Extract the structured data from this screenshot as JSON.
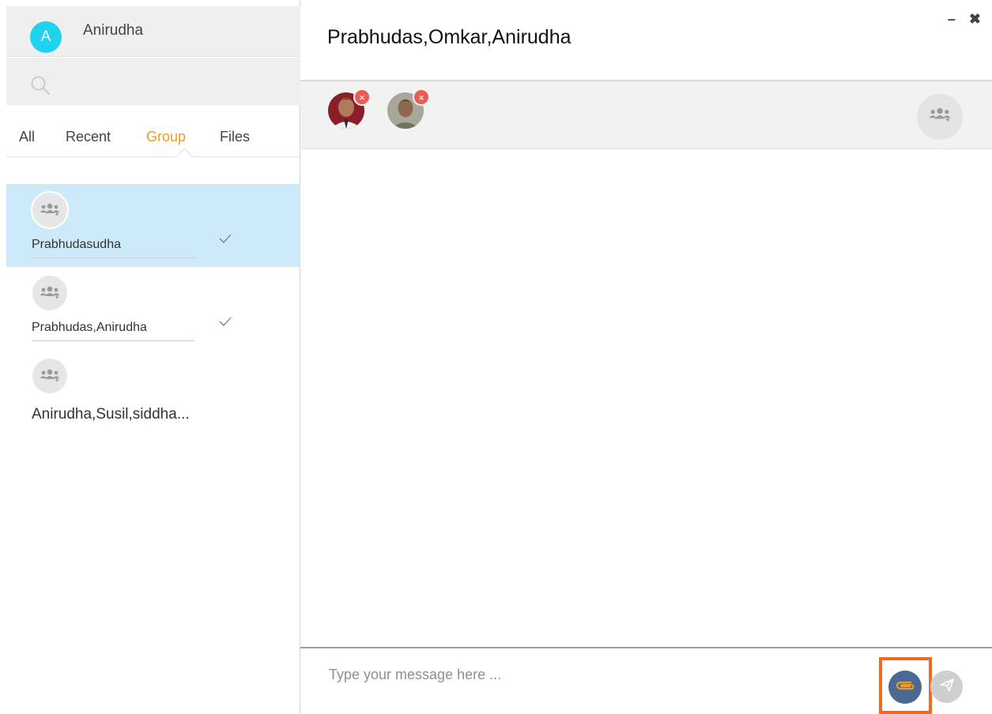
{
  "user": {
    "initial": "A",
    "name": "Anirudha",
    "avatar_color": "#1fd2ef"
  },
  "search": {
    "icon": "search-icon"
  },
  "tabs": [
    {
      "label": "All",
      "active": false
    },
    {
      "label": "Recent",
      "active": false
    },
    {
      "label": "Group",
      "active": true
    },
    {
      "label": "Files",
      "active": false
    }
  ],
  "groups": [
    {
      "name": "Prabhudasudha",
      "selected": true,
      "checked": true
    },
    {
      "name": "Prabhudas,Anirudha",
      "selected": false,
      "checked": true
    },
    {
      "name": "Anirudha,Susil,siddha...",
      "selected": false,
      "checked": false
    }
  ],
  "chat": {
    "title": "Prabhudas,Omkar,Anirudha",
    "members": [
      {
        "icon": "member-photo-1",
        "remove_label": "×"
      },
      {
        "icon": "member-photo-2",
        "remove_label": "×"
      }
    ],
    "add_member_icon": "add-group-icon"
  },
  "window": {
    "minimize_label": "–",
    "close_label": "✖"
  },
  "composer": {
    "placeholder": "Type your message here ...",
    "attach_icon": "paperclip-icon",
    "send_icon": "send-icon"
  },
  "colors": {
    "accent": "#f39a1e",
    "selected_row": "#cdeafa",
    "highlight_box": "#f26a21",
    "attach_button": "#4a6a94",
    "remove_badge": "#e85c55"
  }
}
